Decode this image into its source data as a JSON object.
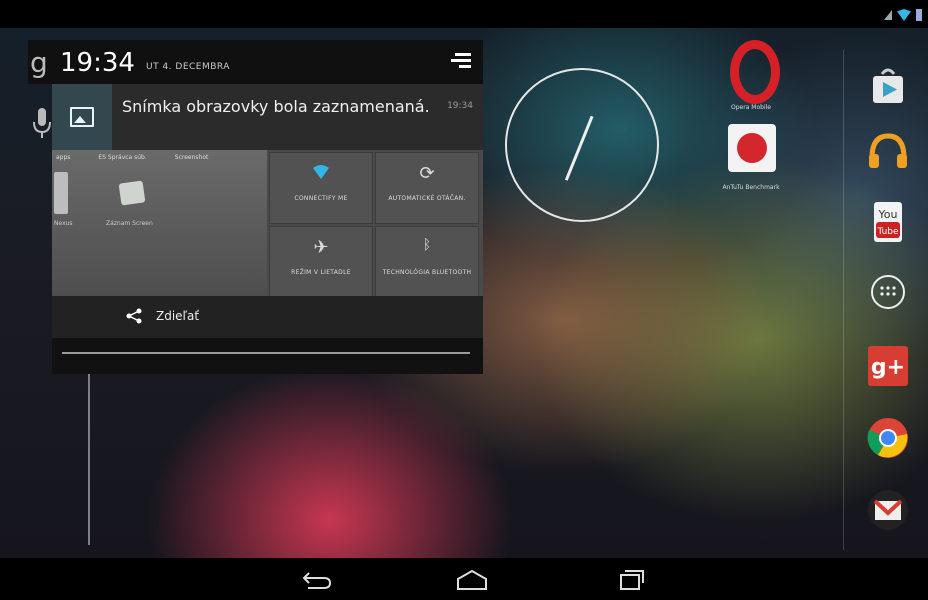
{
  "clock": {
    "time": "19:34",
    "date": "UT 4. DECEMBRA"
  },
  "notification": {
    "title": "Snímka obrazovky bola zaznamenaná.",
    "time": "19:34"
  },
  "preview": {
    "tabs": [
      "apps",
      "ES Správca súb.",
      "Screenshot"
    ],
    "left_text": "Nexus",
    "app_text": "Záznam Screen",
    "tiles": [
      {
        "icon": "wifi-icon",
        "label": "CONNECTIFY ME"
      },
      {
        "icon": "auto-rotate-icon",
        "label": "AUTOMATICKÉ OTÁČAN."
      },
      {
        "icon": "airplane-icon",
        "label": "REŽIM V LIETADLE"
      },
      {
        "icon": "bluetooth-icon",
        "label": "TECHNOLÓGIA BLUETOOTH"
      }
    ]
  },
  "share": {
    "label": "Zdieľať"
  },
  "apps": [
    {
      "label": "Opera Mobile"
    },
    {
      "label": "AnTuTu Benchmark"
    }
  ],
  "hotseat": [
    {
      "name": "Play Store"
    },
    {
      "name": "Play Music"
    },
    {
      "name": "YouTube",
      "text_top": "You",
      "text_bottom": "Tube"
    },
    {
      "name": "All apps"
    },
    {
      "name": "Google+",
      "text": "g+"
    },
    {
      "name": "Chrome"
    },
    {
      "name": "Gmail"
    }
  ],
  "colors": {
    "accent_blue": "#33b5e5",
    "opera_red": "#d62027",
    "gplus_red": "#d73d32"
  }
}
